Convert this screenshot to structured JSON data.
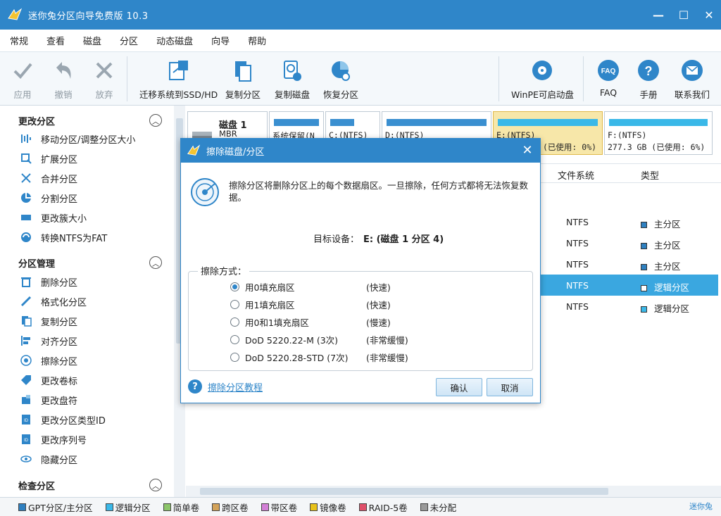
{
  "app": {
    "title": "迷你兔分区向导免费版 10.3"
  },
  "menu": [
    "常规",
    "查看",
    "磁盘",
    "分区",
    "动态磁盘",
    "向导",
    "帮助"
  ],
  "toolbar": {
    "apply": "应用",
    "undo": "撤销",
    "discard": "放弃",
    "migrate": "迁移系统到SSD/HD",
    "copy_partition": "复制分区",
    "copy_disk": "复制磁盘",
    "recover_partition": "恢复分区",
    "winpe": "WinPE可启动盘",
    "faq": "FAQ",
    "manual": "手册",
    "contact": "联系我们"
  },
  "left": {
    "section1": {
      "title": "更改分区",
      "items": [
        "移动分区/调整分区大小",
        "扩展分区",
        "合并分区",
        "分割分区",
        "更改簇大小",
        "转换NTFS为FAT"
      ]
    },
    "section2": {
      "title": "分区管理",
      "items": [
        "删除分区",
        "格式化分区",
        "复制分区",
        "对齐分区",
        "擦除分区",
        "更改卷标",
        "更改盘符",
        "更改分区类型ID",
        "更改序列号",
        "隐藏分区"
      ]
    },
    "section3": {
      "title": "检查分区"
    }
  },
  "disk": {
    "name": "磁盘 1",
    "type": "MBR",
    "partitions": [
      {
        "line1": "系统保留(N",
        "line2": ""
      },
      {
        "line1": "C:(NTFS)",
        "line2": ""
      },
      {
        "line1": "D:(NTFS)",
        "line2": ""
      },
      {
        "line1": "E:(NTFS)",
        "line2": "(已使用: 0%)"
      },
      {
        "line1": "F:(NTFS)",
        "line2": "277.3 GB (已使用: 6%)"
      }
    ]
  },
  "table": {
    "headers": {
      "fs": "文件系统",
      "type": "类型"
    },
    "rows": [
      {
        "fs": "NTFS",
        "type": "主分区",
        "color": "#2f80c0"
      },
      {
        "fs": "NTFS",
        "type": "主分区",
        "color": "#2f80c0"
      },
      {
        "fs": "NTFS",
        "type": "主分区",
        "color": "#2f80c0"
      },
      {
        "fs": "NTFS",
        "type": "逻辑分区",
        "color": "#ffffff"
      },
      {
        "fs": "NTFS",
        "type": "逻辑分区",
        "color": "#3ab8e8"
      }
    ]
  },
  "legend": [
    {
      "label": "GPT分区/主分区",
      "color": "#2f80c0"
    },
    {
      "label": "逻辑分区",
      "color": "#3ab8e8"
    },
    {
      "label": "简单卷",
      "color": "#8cc56a"
    },
    {
      "label": "跨区卷",
      "color": "#d3a35a"
    },
    {
      "label": "带区卷",
      "color": "#d27fd6"
    },
    {
      "label": "镜像卷",
      "color": "#e8c21a"
    },
    {
      "label": "RAID-5卷",
      "color": "#e0506a"
    },
    {
      "label": "未分配",
      "color": "#9a9a9a"
    }
  ],
  "brand": "迷你兔",
  "dialog": {
    "title": "擦除磁盘/分区",
    "description": "擦除分区将删除分区上的每个数据扇区。一旦擦除，任何方式都将无法恢复数据。",
    "target_label": "目标设备：",
    "target_value": "E: (磁盘 1 分区 4)",
    "method_label": "擦除方式：",
    "methods": [
      {
        "name": "用0填充扇区",
        "speed": "(快速)"
      },
      {
        "name": "用1填充扇区",
        "speed": "(快速)"
      },
      {
        "name": "用0和1填充扇区",
        "speed": "(慢速)"
      },
      {
        "name": "DoD 5220.22-M (3次)",
        "speed": "(非常缓慢)"
      },
      {
        "name": "DoD 5220.28-STD (7次)",
        "speed": "(非常缓慢)"
      }
    ],
    "selected_method": 0,
    "help_link": "擦除分区教程",
    "ok": "确认",
    "cancel": "取消"
  }
}
